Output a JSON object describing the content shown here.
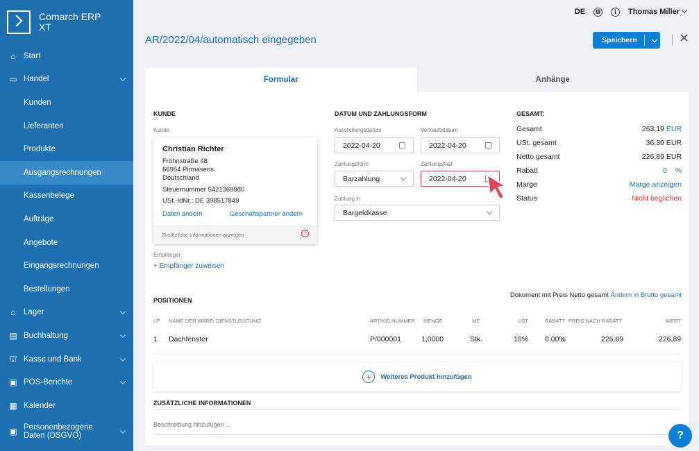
{
  "app": {
    "logo_line1": "Comarch ERP",
    "logo_line2": "XT"
  },
  "sidebar": {
    "items": [
      {
        "label": "Start",
        "icon": "home-icon"
      },
      {
        "label": "Handel",
        "icon": "document-icon"
      },
      {
        "label": "Kunden"
      },
      {
        "label": "Lieferanten"
      },
      {
        "label": "Produkte"
      },
      {
        "label": "Ausgangsrechnungen",
        "active": true
      },
      {
        "label": "Kassenbelege"
      },
      {
        "label": "Aufträge"
      },
      {
        "label": "Angebote"
      },
      {
        "label": "Eingangsrechnungen"
      },
      {
        "label": "Bestellungen"
      },
      {
        "label": "Lager",
        "icon": "warehouse-icon"
      },
      {
        "label": "Buchhaltung",
        "icon": "accounting-icon"
      },
      {
        "label": "Kasse und Bank",
        "icon": "bank-icon"
      },
      {
        "label": "POS-Berichte",
        "icon": "report-icon"
      },
      {
        "label": "Kalender",
        "icon": "calendar-icon"
      },
      {
        "label": "Personenbezogene Daten (DSGVO)",
        "icon": "privacy-icon"
      }
    ]
  },
  "topbar": {
    "lang": "DE",
    "user": "Thomas Miller"
  },
  "header": {
    "title": "AR/2022/04/automatisch eingegeben",
    "save": "Speichern"
  },
  "tabs": [
    "Formular",
    "Anhänge"
  ],
  "customer": {
    "heading": "KUNDE",
    "label": "Kunde",
    "name": "Christian Richter",
    "street": "Fröhnstraße 48",
    "city": "66954 Pirmasens",
    "country": "Deutschland",
    "tax": "Steuernummer 5421369980",
    "vat": "USt.-IdNr.: DE 398517849",
    "edit": "Daten ändern",
    "change_partner": "Geschäftspartner ändern",
    "more_info": "Zusätzliche Informationen anzeigen",
    "recipient_label": "Empfänger",
    "assign_recipient": "+ Empfänger zuweisen"
  },
  "dates": {
    "heading": "DATUM UND ZAHLUNGSFORM",
    "issue_label": "Ausstellungsdatum",
    "issue_value": "2022-04-20",
    "sale_label": "Verkaufsdatum",
    "sale_value": "2022-04-20",
    "payform_label": "Zahlungsform",
    "payform_value": "Barzahlung",
    "deadline_label": "Zahlungsfrist",
    "deadline_value": "2022-04-20",
    "payin_label": "Zahlung in",
    "payin_value": "Bargeldkasse"
  },
  "totals": {
    "heading": "GESAMT:",
    "gross_label": "Gesamt",
    "gross_value": "263,19",
    "gross_cur": "EUR",
    "vat_label": "USt. gesamt",
    "vat_value": "36,30 EUR",
    "net_label": "Netto gesamt",
    "net_value": "226,89 EUR",
    "discount_label": "Rabatt",
    "discount_value": "0",
    "discount_unit": "%",
    "margin_label": "Marge",
    "margin_value": "Marge anzeigen",
    "status_label": "Status",
    "status_value": "Nicht beglichen"
  },
  "positions": {
    "heading": "POSITIONEN",
    "note": "Dokument mit Preis Netto gesamt",
    "note_link": "Ändern in Brutto gesamt",
    "columns": [
      "LP",
      "NAME DER WARE/ DIENSTLEISTUNG",
      "ARTIKELNUMMER",
      "MENGE",
      "ME",
      "UST.",
      "RABATT",
      "PREIS NACH RABATT",
      "WERT"
    ],
    "rows": [
      {
        "lp": "1",
        "name": "Dachfenster",
        "artnr": "P/000001",
        "qty": "1,0000",
        "unit": "Stk.",
        "vat": "16%",
        "discount": "0,00%",
        "price": "226,89",
        "value": "226,89"
      }
    ],
    "add_product": "Weiteres Produkt hinzufügen"
  },
  "additional": {
    "heading": "ZUSÄTZLICHE INFORMATIONEN",
    "placeholder": "Beschreibung hinzufügen ..."
  },
  "colors": {
    "sidebar": "#1e6fb0",
    "accent": "#0c7fd6",
    "error": "#e33"
  }
}
